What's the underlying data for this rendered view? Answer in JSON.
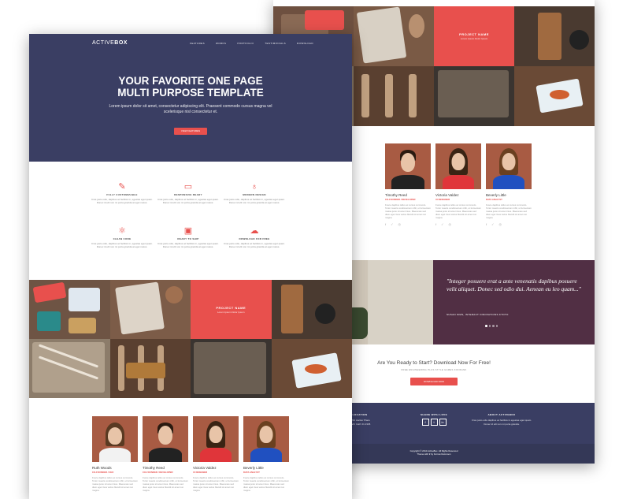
{
  "brand": {
    "logo_a": "ACTIVE",
    "logo_b": "BOX"
  },
  "nav": [
    "FEATURES",
    "WORKS",
    "PORTFOLIO",
    "TESTIMONIALS",
    "DOWNLOAD"
  ],
  "hero": {
    "title_line1": "YOUR FAVORITE ONE PAGE",
    "title_line2": "MULTI PURPOSE TEMPLATE",
    "lead": "Lorem ipsum dolor sit amet, consectetur adipiscing elit. Praesent commodo cursus magna vel scelerisque nisl consectetur et.",
    "button": "VIEW FEATURES"
  },
  "features": [
    {
      "title": "FULLY CUSTOMIZABLE",
      "icon": "pencil-ruler-icon",
      "glyph": "✎",
      "desc": "Cras justo odio, dapibus ac facilisis in, egestas eget quam. Donec id elit non mi porta gravida at eget metus."
    },
    {
      "title": "RESPONSIVE READY",
      "icon": "monitor-icon",
      "glyph": "▭",
      "desc": "Cras justo odio, dapibus ac facilisis in, egestas eget quam. Donec id elit non mi porta gravida at eget metus."
    },
    {
      "title": "MODERN DESIGN",
      "icon": "lightbulb-icon",
      "glyph": "♁",
      "desc": "Cras justo odio, dapibus ac facilisis in, egestas eget quam. Donec id elit non mi porta gravida at eget metus."
    },
    {
      "title": "CLEAN CODE",
      "icon": "atom-icon",
      "glyph": "⚛",
      "desc": "Cras justo odio, dapibus ac facilisis in, egestas eget quam. Donec id elit non mi porta gravida at eget metus."
    },
    {
      "title": "READY TO SHIP",
      "icon": "briefcase-icon",
      "glyph": "▣",
      "desc": "Cras justo odio, dapibus ac facilisis in, egestas eget quam. Donec id elit non mi porta gravida at eget metus."
    },
    {
      "title": "DOWNLOAD FOR FREE",
      "icon": "cloud-download-icon",
      "glyph": "☁",
      "desc": "Cras justo odio, dapibus ac facilisis in, egestas eget quam. Donec id elit non mi porta gravida at eget metus."
    }
  ],
  "portfolio_overlay": {
    "title": "PROJECT NAME",
    "subtitle": "Lorem Ipsum Dolor Ipsum"
  },
  "team": [
    {
      "name": "Ruth Woods",
      "role": "CO-FOUNDER / CEO",
      "bio": "Fusce dapibus tellus ac cursus commodo. Tortor mauris condimentum nibh, ut fermentum massa justo sit amet risus. Maecenas sed diam eget risus varius blandit sit amet non magna.",
      "hair": "#5a3a22",
      "shirt": "#f2f2f2"
    },
    {
      "name": "Timothy Reed",
      "role": "CO-FOUNDER / DEVELOPER",
      "bio": "Fusce dapibus tellus ac cursus commodo. Tortor mauris condimentum nibh, ut fermentum massa justo sit amet risus. Maecenas sed diam eget risus varius blandit sit amet non magna.",
      "hair": "#2a1a10",
      "shirt": "#222222"
    },
    {
      "name": "Victoria Valdez",
      "role": "UI DESIGNER",
      "bio": "Fusce dapibus tellus ac cursus commodo. Tortor mauris condimentum nibh, ut fermentum massa justo sit amet risus. Maecenas sed diam eget risus varius blandit sit amet non magna.",
      "hair": "#3a2414",
      "shirt": "#e0353a"
    },
    {
      "name": "Beverly Little",
      "role": "DATA ANALYST",
      "bio": "Fusce dapibus tellus ac cursus commodo. Tortor mauris condimentum nibh, ut fermentum massa justo sit amet risus. Maecenas sed diam eget risus varius blandit sit amet non magna.",
      "hair": "#6a4020",
      "shirt": "#2050c0"
    }
  ],
  "social_icons": [
    "f",
    "✓",
    "◎"
  ],
  "testimonial": {
    "quote": "\"Integer posuere erat a ante venenatis dapibus posuere velit aliquet. Donec sed odio dui. Aenean eu leo quam...\"",
    "author": "SUSAN SIMS, INTERACT INNOVATIONS KTOTO"
  },
  "cta": {
    "title": "Are You Ready to Start? Download Now For Free!",
    "subtitle": "FREE ENGINEERING PLUS STYLE GAMES KONKANK",
    "button": "DOWNLOAD NOW"
  },
  "footer": {
    "location_title": "LOCATION",
    "location_text": "1234 Hacker Place\nNorth Calif. 01 2345",
    "social_title": "SHARE WITH LOVE",
    "social": [
      "f",
      "t",
      "in"
    ],
    "about_title": "ABOUT ACTIVEBOX",
    "about_text": "Cras justo odio dapibus ac facilisis in egestas eget quam. Donec id elit non mi porta gravida.",
    "copyright": "Copyright © 2014 ActiveBox. All Rights Reserved",
    "credit": "Theme with ♥ by Furrow Dezeroon"
  },
  "colors": {
    "navy": "#3a3e63",
    "accent": "#e8504d",
    "plum": "#512f44"
  }
}
